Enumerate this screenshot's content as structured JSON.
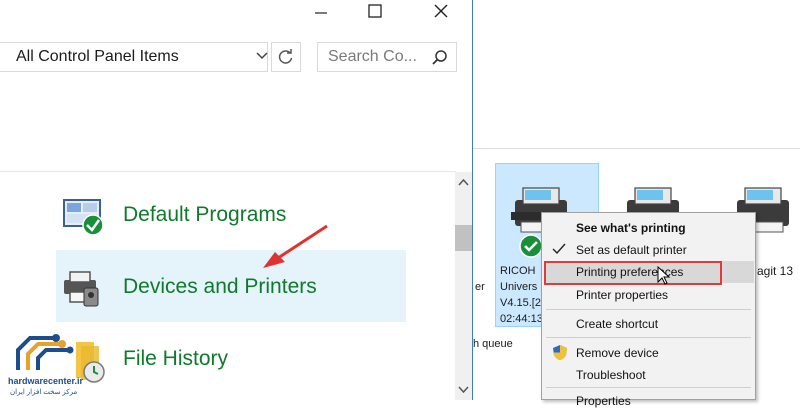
{
  "left_window": {
    "address": "All Control Panel Items",
    "search_placeholder": "Search Co...",
    "items": [
      {
        "label": "Default Programs",
        "icon": "default-programs-icon"
      },
      {
        "label": "Devices and Printers",
        "icon": "devices-printers-icon",
        "highlighted": true
      },
      {
        "label": "File History",
        "icon": "file-history-icon"
      }
    ],
    "title_buttons": [
      "minimize",
      "maximize",
      "close"
    ]
  },
  "right_window": {
    "printer": {
      "line1": "RICOH",
      "line2": "Univers",
      "line3": "V4.15.[2",
      "line4": "02:44:13"
    },
    "partial_left": "er",
    "partial_right": "agit 13",
    "queue_text": "h queue"
  },
  "context_menu": {
    "items": [
      {
        "label": "See what's printing",
        "bold": true
      },
      {
        "label": "Set as default printer",
        "icon": "check-icon"
      },
      {
        "label": "Printing preferences",
        "hovered": true
      },
      {
        "label": "Printer properties"
      },
      {
        "label": "Create shortcut"
      },
      {
        "label": "Remove device",
        "icon": "shield-icon"
      },
      {
        "label": "Troubleshoot"
      },
      {
        "label": "Properties"
      }
    ]
  },
  "watermark": {
    "site": "hardwarecenter.ir",
    "tagline": "مرکز سخت افزار ایران"
  },
  "colors": {
    "link_green": "#0f7a2c",
    "highlight": "#e5f3fb",
    "selection_blue": "#cce8ff",
    "annotation_red": "#e03b3b"
  }
}
